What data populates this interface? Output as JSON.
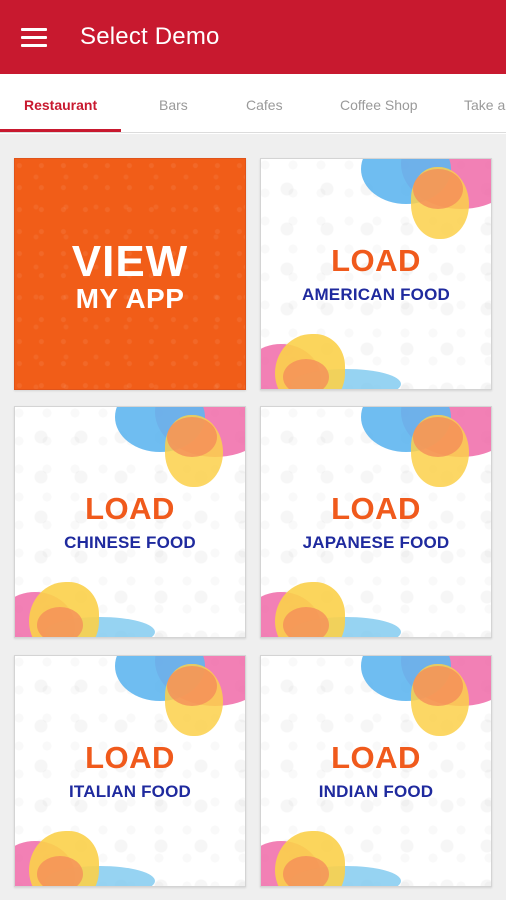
{
  "appbar": {
    "title": "Select Demo",
    "menu_icon": "hamburger-menu-icon",
    "color": "#c8192f"
  },
  "tabs": [
    {
      "label": "Restaurant",
      "active": true
    },
    {
      "label": "Bars",
      "active": false
    },
    {
      "label": "Cafes",
      "active": false
    },
    {
      "label": "Coffee Shop",
      "active": false
    },
    {
      "label": "Take a",
      "active": false
    }
  ],
  "tiles": {
    "view": {
      "line1": "VIEW",
      "line2": "MY APP",
      "color": "#f15d18"
    },
    "load_label": "LOAD",
    "american": {
      "label": "LOAD",
      "food": "AMERICAN FOOD"
    },
    "chinese": {
      "label": "LOAD",
      "food": "CHINESE FOOD"
    },
    "japanese": {
      "label": "LOAD",
      "food": "JAPANESE FOOD"
    },
    "italian": {
      "label": "LOAD",
      "food": "ITALIAN FOOD"
    },
    "indian": {
      "label": "LOAD",
      "food": "INDIAN FOOD"
    }
  },
  "colors": {
    "accent": "#c8192f",
    "load_orange": "#f05a1c",
    "food_blue": "#1f2a9e"
  }
}
